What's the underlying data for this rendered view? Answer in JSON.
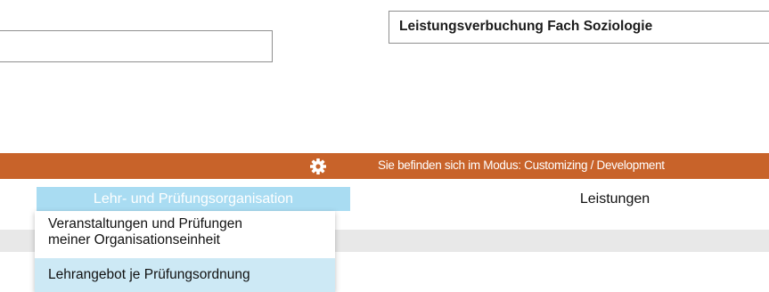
{
  "header": {
    "title": "Leistungsverbuchung Fach Soziologie",
    "left_input_value": ""
  },
  "mode_bar": {
    "text": "Sie befinden sich im Modus: Customizing / Development",
    "icon": "gear-icon",
    "color": "#c8632a"
  },
  "nav": {
    "active_tab": "Lehr- und Prüfungsorganisation",
    "tab_leistungen": "Leistungen"
  },
  "dropdown": {
    "items": [
      {
        "line1": "Veranstaltungen und Prüfungen",
        "line2": "meiner Organisationseinheit"
      },
      {
        "label": "Lehrangebot je Prüfungsordnung"
      }
    ]
  },
  "colors": {
    "accent_orange": "#c8632a",
    "active_tab_bg": "#a9dcf2",
    "hover_item_bg": "#cde9f5"
  }
}
